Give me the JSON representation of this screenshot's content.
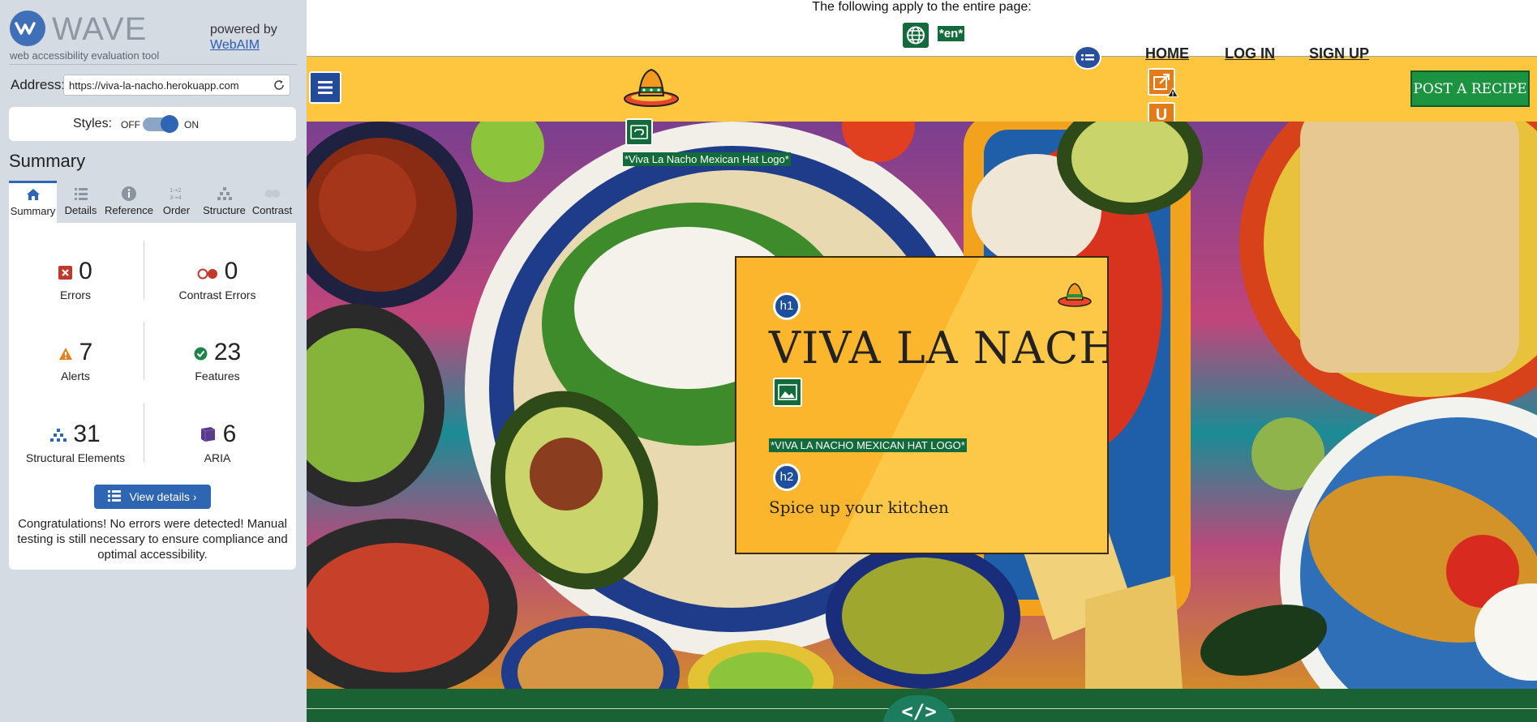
{
  "wave": {
    "brand_name": "WAVE",
    "tagline": "web accessibility evaluation tool",
    "powered_by": "powered by",
    "powered_link": "WebAIM",
    "address_label": "Address:",
    "address_value": "https://viva-la-nacho.herokuapp.com",
    "styles_label": "Styles:",
    "styles_off": "OFF",
    "styles_on": "ON",
    "styles_state": "on",
    "summary_heading": "Summary",
    "tabs": [
      {
        "label": "Summary",
        "icon": "home-icon",
        "active": true
      },
      {
        "label": "Details",
        "icon": "list-icon",
        "active": false
      },
      {
        "label": "Reference",
        "icon": "info-icon",
        "active": false
      },
      {
        "label": "Order",
        "icon": "order-icon",
        "active": false
      },
      {
        "label": "Structure",
        "icon": "hierarchy-icon",
        "active": false
      },
      {
        "label": "Contrast",
        "icon": "contrast-icon",
        "active": false
      }
    ],
    "stats": {
      "errors": {
        "count": "0",
        "label": "Errors",
        "color": "#c0392b"
      },
      "contrast_errors": {
        "count": "0",
        "label": "Contrast Errors",
        "color": "#c0392b"
      },
      "alerts": {
        "count": "7",
        "label": "Alerts",
        "color": "#e67e22"
      },
      "features": {
        "count": "23",
        "label": "Features",
        "color": "#1e8449"
      },
      "structural": {
        "count": "31",
        "label": "Structural Elements",
        "color": "#2f66b3"
      },
      "aria": {
        "count": "6",
        "label": "ARIA",
        "color": "#5b3a8e"
      }
    },
    "view_details": "View details ›",
    "congrats": "Congratulations! No errors were detected! Manual testing is still necessary to ensure compliance and optimal accessibility."
  },
  "page": {
    "banner_text": "The following apply to the entire page:",
    "lang_tag": "*en*",
    "nav_links": [
      "HOME",
      "LOG IN",
      "SIGN UP"
    ],
    "post_recipe": "POST A RECIPE",
    "alt_label_logo": "*Viva La Nacho Mexican Hat Logo*",
    "card_title": "VIVA LA NACHO",
    "alt_label_card": "*VIVA LA NACHO MEXICAN HAT LOGO*",
    "card_subtitle": "Spice up your kitchen",
    "h1_badge": "h1",
    "h2_badge": "h2",
    "underline_badge": "U",
    "code_badge": "</>",
    "colors": {
      "nav_yellow": "#fdc63e",
      "wave_green": "#136b3c",
      "wave_blue": "#2f66b3",
      "alert_orange": "#e47a18",
      "post_button": "#1b9341"
    }
  }
}
